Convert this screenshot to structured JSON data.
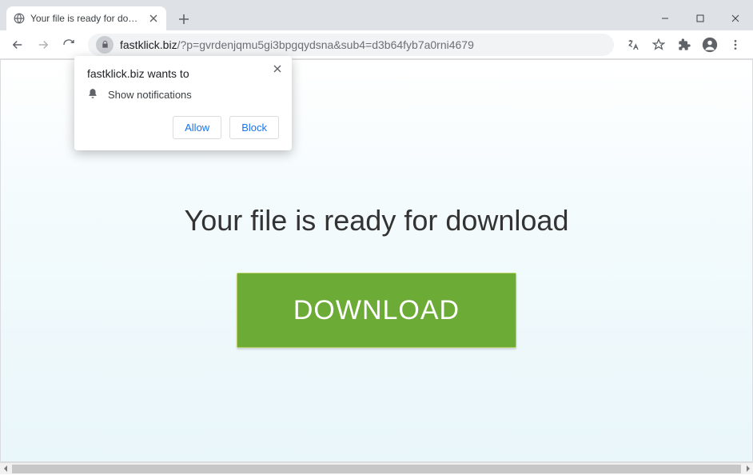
{
  "tab": {
    "title": "Your file is ready for download"
  },
  "omnibox": {
    "domain": "fastklick.biz",
    "path": "/?p=gvrdenjqmu5gi3bpgqydsna&sub4=d3b64fyb7a0rni4679"
  },
  "page": {
    "headline": "Your file is ready for download",
    "download_label": "DOWNLOAD"
  },
  "permission_prompt": {
    "title": "fastklick.biz wants to",
    "item": "Show notifications",
    "allow_label": "Allow",
    "block_label": "Block"
  }
}
